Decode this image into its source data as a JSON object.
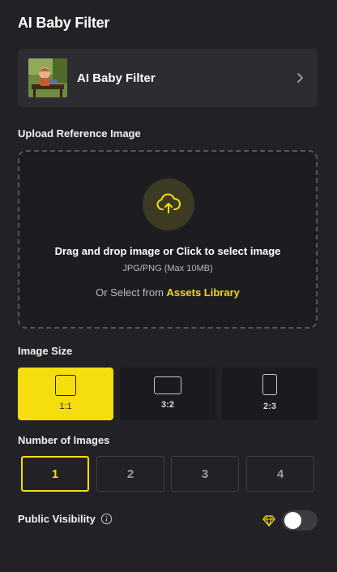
{
  "header": {
    "title": "AI Baby Filter"
  },
  "filter_card": {
    "label": "AI Baby Filter",
    "thumbnail_icon": "baby-photo-thumbnail",
    "chevron_icon": "chevron-right-icon"
  },
  "upload": {
    "section_label": "Upload Reference Image",
    "icon": "cloud-upload-icon",
    "title": "Drag and drop image or Click to select image",
    "subtitle": "JPG/PNG (Max 10MB)",
    "alt_prefix": "Or Select from",
    "alt_link": "Assets Library"
  },
  "image_size": {
    "section_label": "Image Size",
    "options": [
      {
        "label": "1:1",
        "selected": true
      },
      {
        "label": "3:2",
        "selected": false
      },
      {
        "label": "2:3",
        "selected": false
      }
    ]
  },
  "number_of_images": {
    "section_label": "Number of Images",
    "options": [
      {
        "label": "1",
        "selected": true
      },
      {
        "label": "2",
        "selected": false
      },
      {
        "label": "3",
        "selected": false
      },
      {
        "label": "4",
        "selected": false
      }
    ]
  },
  "visibility": {
    "label": "Public Visibility",
    "info_icon": "info-icon",
    "premium_icon": "diamond-icon",
    "toggle_on": false
  },
  "colors": {
    "accent": "#f5de0e",
    "background": "#222226",
    "card": "#2c2c31"
  }
}
